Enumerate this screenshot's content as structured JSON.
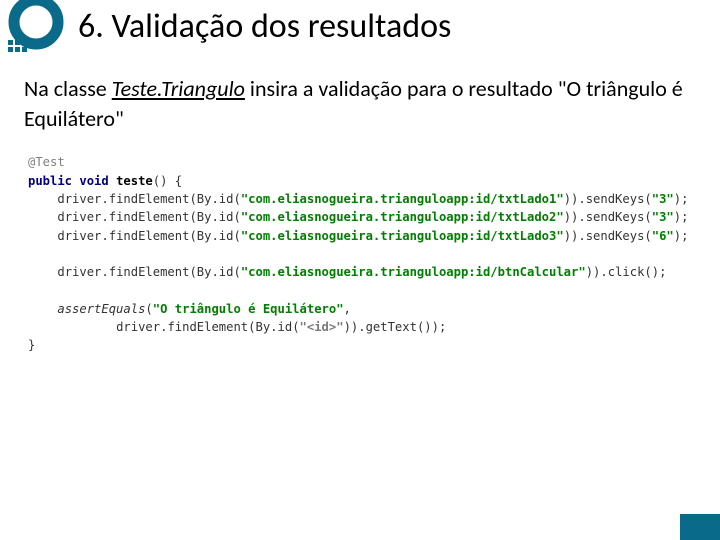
{
  "header": {
    "title": "6. Validação dos resultados"
  },
  "instruction": {
    "prefix": "Na classe ",
    "class_name": "Teste.Triangulo",
    "suffix": " insira a validação para o resultado \"O triângulo é Equilátero\""
  },
  "code": {
    "annotation": "@Test",
    "keywords": {
      "public": "public",
      "void": "void"
    },
    "method": "teste",
    "lines": [
      {
        "obj": "driver",
        "call1": "findElement",
        "byid": "By.id",
        "arg": "\"com.eliasnogueira.trianguloapp:id/txtLado1\"",
        "tail": ".sendKeys(",
        "tailarg": "\"3\"",
        "end": ");"
      },
      {
        "obj": "driver",
        "call1": "findElement",
        "byid": "By.id",
        "arg": "\"com.eliasnogueira.trianguloapp:id/txtLado2\"",
        "tail": ".sendKeys(",
        "tailarg": "\"3\"",
        "end": ");"
      },
      {
        "obj": "driver",
        "call1": "findElement",
        "byid": "By.id",
        "arg": "\"com.eliasnogueira.trianguloapp:id/txtLado3\"",
        "tail": ".sendKeys(",
        "tailarg": "\"6\"",
        "end": ");"
      },
      {
        "obj": "driver",
        "call1": "findElement",
        "byid": "By.id",
        "arg": "\"com.eliasnogueira.trianguloapp:id/btnCalcular\"",
        "tail": ".click();",
        "tailarg": "",
        "end": ""
      }
    ],
    "assert": {
      "fn": "assertEquals",
      "expected": "\"O triângulo é Equilátero\"",
      "obj": "driver",
      "call1": "findElement",
      "byid": "By.id",
      "arg": "\"<id>\"",
      "tail": ".getText());"
    },
    "braces": {
      "open": "() {",
      "close": "}"
    }
  }
}
